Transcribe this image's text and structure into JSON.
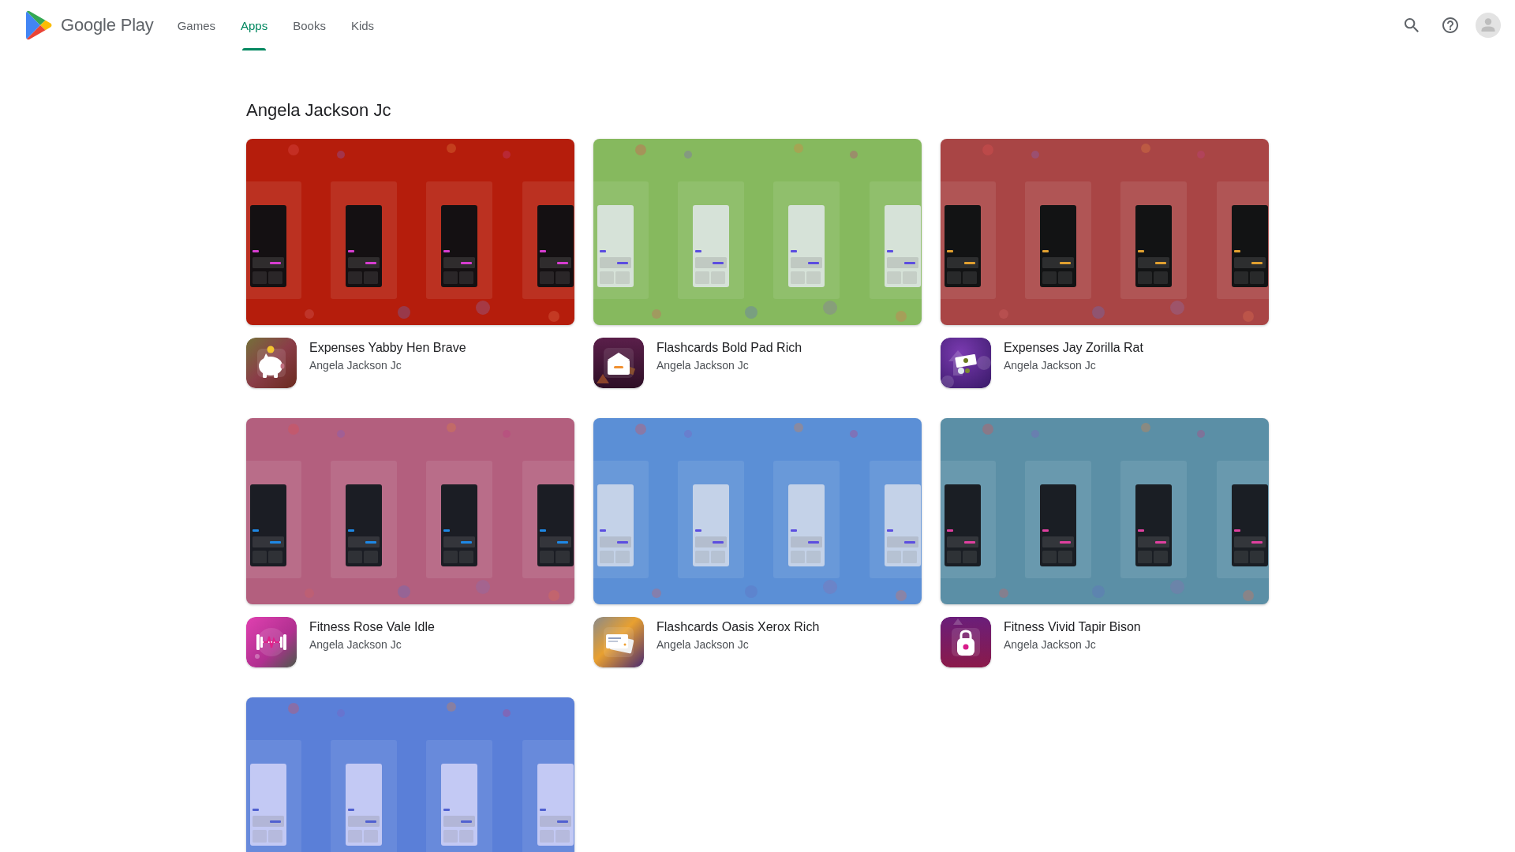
{
  "header": {
    "logo_text": "Google Play",
    "tabs": [
      {
        "label": "Games",
        "selected": false
      },
      {
        "label": "Apps",
        "selected": true
      },
      {
        "label": "Books",
        "selected": false
      },
      {
        "label": "Kids",
        "selected": false
      }
    ]
  },
  "developer_page": {
    "title": "Angela Jackson Jc",
    "apps": [
      {
        "name": "Expenses Yabby Hen Brave",
        "developer": "Angela Jackson Jc",
        "color": "#b51d0c"
      },
      {
        "name": "Flashcards Bold Pad Rich",
        "developer": "Angela Jackson Jc",
        "color": "#86b95e"
      },
      {
        "name": "Expenses Jay Zorilla Rat",
        "developer": "Angela Jackson Jc",
        "color": "#a94545"
      },
      {
        "name": "Fitness Rose Vale Idle",
        "developer": "Angela Jackson Jc",
        "color": "#b35f7e"
      },
      {
        "name": "Flashcards Oasis Xerox Rich",
        "developer": "Angela Jackson Jc",
        "color": "#5b8fd6"
      },
      {
        "name": "Fitness Vivid Tapir Bison",
        "developer": "Angela Jackson Jc",
        "color": "#5b8fa6"
      },
      {
        "color": "#5a7fd8"
      }
    ]
  }
}
